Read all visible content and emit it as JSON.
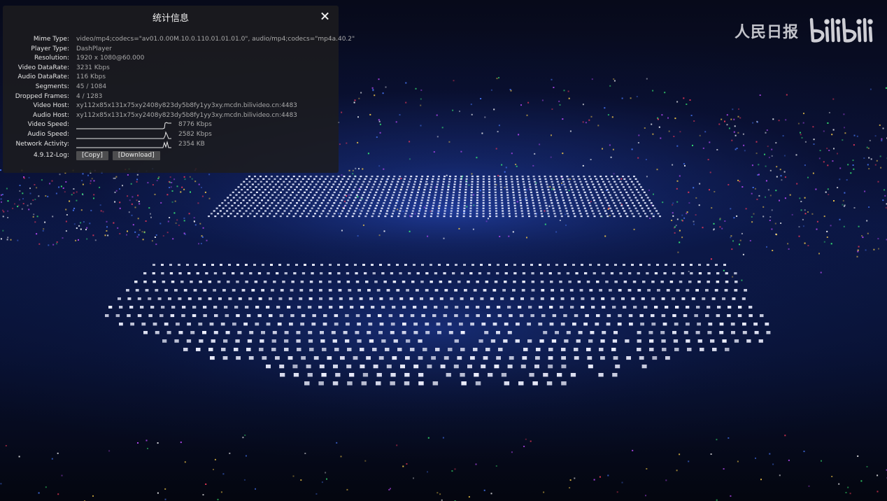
{
  "stats": {
    "title": "统计信息",
    "rows": [
      {
        "label": "Mime Type:",
        "value": "video/mp4;codecs=\"av01.0.00M.10.0.110.01.01.01.0\", audio/mp4;codecs=\"mp4a.40.2\""
      },
      {
        "label": "Player Type:",
        "value": "DashPlayer"
      },
      {
        "label": "Resolution:",
        "value": "1920 x 1080@60.000"
      },
      {
        "label": "Video DataRate:",
        "value": "3231 Kbps"
      },
      {
        "label": "Audio DataRate:",
        "value": "116 Kbps"
      },
      {
        "label": "Segments:",
        "value": "45 / 1084"
      },
      {
        "label": "Dropped Frames:",
        "value": "4 / 1283"
      },
      {
        "label": "Video Host:",
        "value": "xy112x85x131x75xy2408y823dy5b8fy1yy3xy.mcdn.bilivideo.cn:4483"
      },
      {
        "label": "Audio Host:",
        "value": "xy112x85x131x75xy2408y823dy5b8fy1yy3xy.mcdn.bilivideo.cn:4483"
      }
    ],
    "speeds": [
      {
        "label": "Video Speed:",
        "value": "8776 Kbps"
      },
      {
        "label": "Audio Speed:",
        "value": "2582 Kbps"
      },
      {
        "label": "Network Activity:",
        "value": "2354 KB"
      }
    ],
    "log": {
      "label": "4.9.12-Log:",
      "copy": "[Copy]",
      "download": "[Download]"
    }
  },
  "watermark": {
    "paper": "人民日报"
  },
  "colors": {
    "panel_bg": "#1c1c1e",
    "accent_text": "#e6e6e6",
    "muted_text": "#a9a9a9",
    "button_bg": "#4d4d4f"
  }
}
